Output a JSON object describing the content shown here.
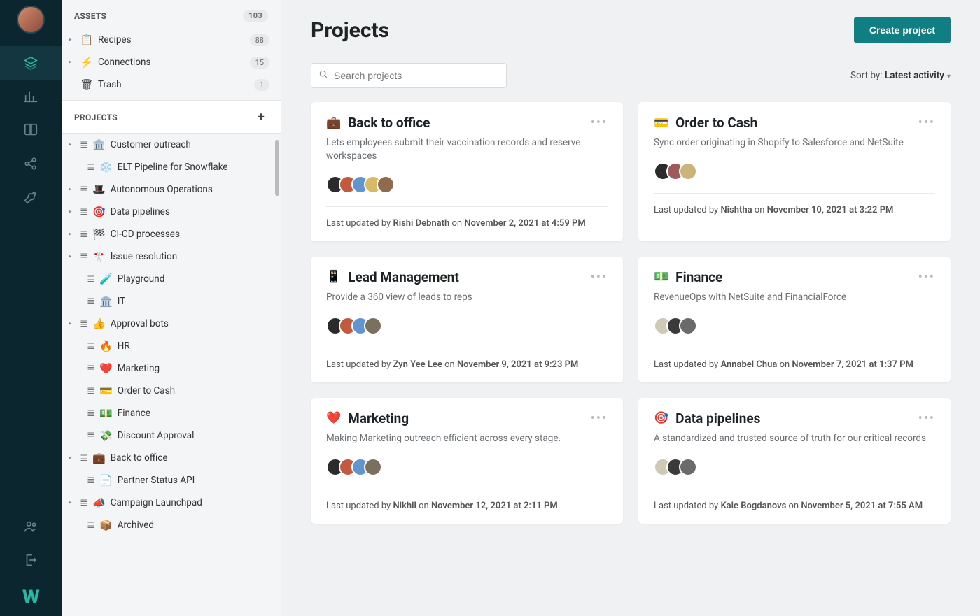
{
  "rail": {
    "logo": "W"
  },
  "sidebar": {
    "assets_header": "ASSETS",
    "assets_count": "103",
    "assets": [
      {
        "icon": "📋",
        "label": "Recipes",
        "count": "88"
      },
      {
        "icon": "⚡",
        "label": "Connections",
        "count": "15"
      },
      {
        "icon": "🗑",
        "label": "Trash",
        "count": "1"
      }
    ],
    "projects_header": "PROJECTS",
    "tree": [
      {
        "emoji": "🏛️",
        "label": "Customer outreach",
        "chev": true
      },
      {
        "emoji": "❄️",
        "label": "ELT Pipeline for Snowflake",
        "chev": false,
        "indent": true
      },
      {
        "emoji": "🎩",
        "label": "Autonomous Operations",
        "chev": true
      },
      {
        "emoji": "🎯",
        "label": "Data pipelines",
        "chev": true
      },
      {
        "emoji": "🏁",
        "label": "CI-CD processes",
        "chev": true
      },
      {
        "emoji": "🎌",
        "label": "Issue resolution",
        "chev": true
      },
      {
        "emoji": "🧪",
        "label": "Playground",
        "chev": false,
        "indent": true
      },
      {
        "emoji": "🏛️",
        "label": "IT",
        "chev": false,
        "indent": true
      },
      {
        "emoji": "👍",
        "label": "Approval bots",
        "chev": true
      },
      {
        "emoji": "🔥",
        "label": "HR",
        "chev": false,
        "indent": true
      },
      {
        "emoji": "❤️",
        "label": "Marketing",
        "chev": false,
        "indent": true
      },
      {
        "emoji": "💳",
        "label": "Order to Cash",
        "chev": false,
        "indent": true
      },
      {
        "emoji": "💵",
        "label": "Finance",
        "chev": false,
        "indent": true
      },
      {
        "emoji": "💸",
        "label": "Discount Approval",
        "chev": false,
        "indent": true
      },
      {
        "emoji": "💼",
        "label": "Back to office",
        "chev": true
      },
      {
        "emoji": "📄",
        "label": "Partner Status API",
        "chev": false,
        "indent": true
      },
      {
        "emoji": "📣",
        "label": "Campaign Launchpad",
        "chev": true
      },
      {
        "emoji": "📦",
        "label": "Archived",
        "chev": false,
        "indent": true
      }
    ]
  },
  "header": {
    "title": "Projects",
    "create_label": "Create project"
  },
  "toolbar": {
    "search_placeholder": "Search projects",
    "sort_prefix": "Sort by: ",
    "sort_value": "Latest activity"
  },
  "cards": [
    {
      "emoji": "💼",
      "title": "Back to office",
      "desc": "Lets employees submit their vaccination records and reserve workspaces",
      "avatar_count": 5,
      "avatar_colors": [
        "#2b2b2b",
        "#c15a3f",
        "#6295cf",
        "#d8b964",
        "#8f6a4c"
      ],
      "updated_by": "Rishi Debnath",
      "updated_on": "November 2, 2021 at 4:59 PM"
    },
    {
      "emoji": "💳",
      "title": "Order to Cash",
      "desc": "Sync order originating in Shopify to Salesforce and NetSuite",
      "avatar_count": 3,
      "avatar_colors": [
        "#2b2b2b",
        "#a05a5a",
        "#cbb37a"
      ],
      "updated_by": "Nishtha",
      "updated_on": "November 10, 2021 at 3:22 PM"
    },
    {
      "emoji": "📱",
      "title": "Lead Management",
      "desc": "Provide a 360 view of leads to reps",
      "avatar_count": 4,
      "avatar_colors": [
        "#2b2b2b",
        "#c15a3f",
        "#6295cf",
        "#7a7060"
      ],
      "updated_by": "Zyn Yee Lee",
      "updated_on": "November 9, 2021 at 9:23 PM"
    },
    {
      "emoji": "💵",
      "title": "Finance",
      "desc": "RevenueOps with NetSuite and FinancialForce",
      "avatar_count": 3,
      "avatar_colors": [
        "#d0c9b8",
        "#3a3a3a",
        "#6a6a6a"
      ],
      "updated_by": "Annabel Chua",
      "updated_on": "November 7, 2021 at 1:37 PM"
    },
    {
      "emoji": "❤️",
      "title": "Marketing",
      "desc": "Making Marketing outreach efficient across every stage.",
      "avatar_count": 4,
      "avatar_colors": [
        "#2b2b2b",
        "#c15a3f",
        "#6295cf",
        "#7a7060"
      ],
      "updated_by": "Nikhil",
      "updated_on": "November 12, 2021 at 2:11 PM"
    },
    {
      "emoji": "🎯",
      "title": "Data pipelines",
      "desc": "A standardized and trusted source of truth for our critical records",
      "avatar_count": 3,
      "avatar_colors": [
        "#d0c9b8",
        "#3a3a3a",
        "#6a6a6a"
      ],
      "updated_by": "Kale Bogdanovs",
      "updated_on": "November 5, 2021 at 7:55 AM"
    }
  ],
  "labels": {
    "updated_prefix": "Last updated by ",
    "on": " on "
  }
}
